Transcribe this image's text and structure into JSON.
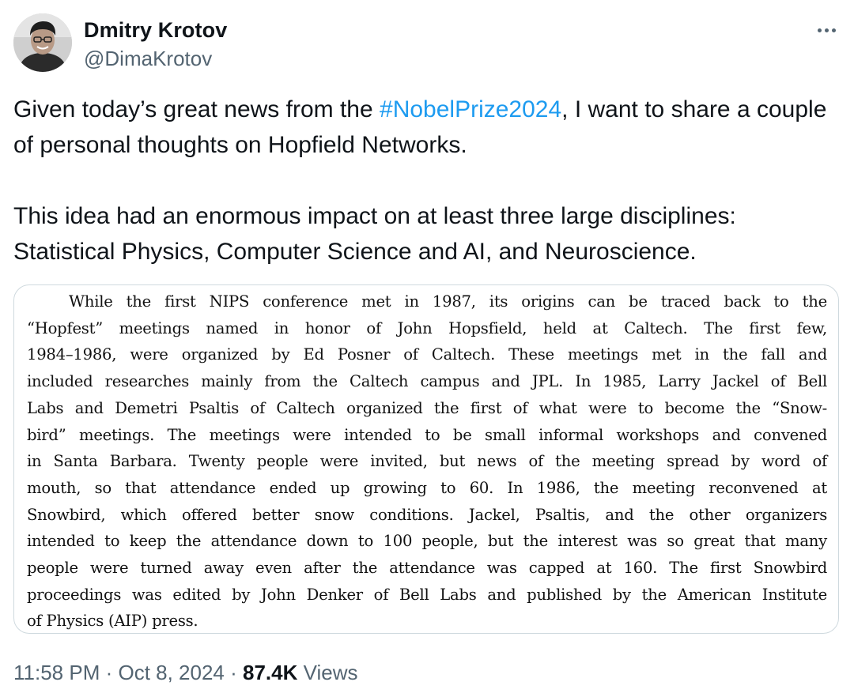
{
  "author": {
    "name": "Dmitry Krotov",
    "handle": "@DimaKrotov",
    "avatar_icon": "profile-photo"
  },
  "more_icon": "more-horizontal-icon",
  "tweet": {
    "para1_before": "Given today’s great news from the ",
    "hashtag": "#NobelPrize2024",
    "para1_after": ", I want to share a couple of personal thoughts on Hopfield Networks.",
    "para2": "This idea had an enormous impact on at least three large disciplines: Statistical Physics, Computer Science and AI, and Neuroscience."
  },
  "scan_lines": [
    "While the first NIPS conference met in 1987, its origins can be traced back to the",
    "“Hopfest” meetings named in honor of John Hopsfield, held at Caltech. The first few,",
    "1984–1986, were organized by Ed Posner of Caltech. These meetings met in the fall and",
    "included researches mainly from the Caltech campus and JPL. In 1985, Larry Jackel of Bell",
    "Labs and Demetri Psaltis of Caltech organized the first of what were to become the “Snow-",
    "bird” meetings. The meetings were intended to be small informal workshops and convened",
    "in Santa Barbara. Twenty people were invited, but news of the meeting spread by word of",
    "mouth, so that attendance ended up growing to 60. In 1986, the meeting reconvened at",
    "Snowbird, which offered better snow conditions. Jackel, Psaltis, and the other organizers",
    "intended to keep the attendance down to 100 people, but the interest was so great that many",
    "people were turned away even after the attendance was capped at 160. The first Snowbird",
    "proceedings was edited by John Denker of Bell Labs and published by the American Institute",
    "of Physics (AIP) press."
  ],
  "meta": {
    "time": "11:58 PM",
    "separator": " · ",
    "date": "Oct 8, 2024",
    "views_count": "87.4K",
    "views_label": " Views"
  },
  "colors": {
    "link": "#1d9bf0",
    "secondary_text": "#536471",
    "primary_text": "#0f1419",
    "border": "#cfd9de"
  }
}
